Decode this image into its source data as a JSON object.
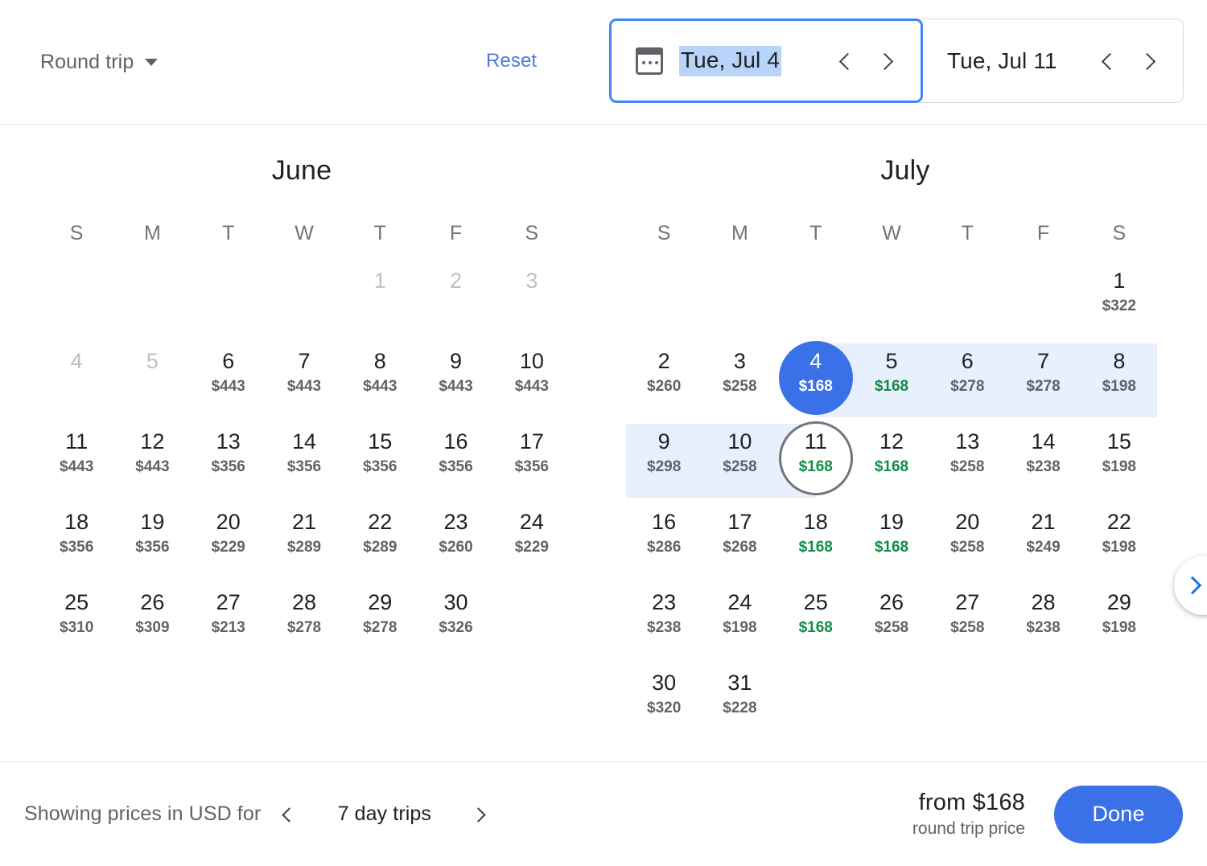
{
  "header": {
    "trip_type": "Round trip",
    "trip_type_icon": "chevron-down-icon",
    "reset_label": "Reset",
    "depart": {
      "icon": "calendar-icon",
      "value": "Tue, Jul 4",
      "prev_icon": "chevron-left-icon",
      "next_icon": "chevron-right-icon"
    },
    "return": {
      "value": "Tue, Jul 11",
      "prev_icon": "chevron-left-icon",
      "next_icon": "chevron-right-icon"
    }
  },
  "weekday_headers": [
    "S",
    "M",
    "T",
    "W",
    "T",
    "F",
    "S"
  ],
  "months": [
    {
      "name": "June",
      "lead_blanks": 4,
      "days": [
        {
          "day": "1",
          "price": "",
          "state": "disabled"
        },
        {
          "day": "2",
          "price": "",
          "state": "disabled"
        },
        {
          "day": "3",
          "price": "",
          "state": "disabled"
        },
        {
          "day": "4",
          "price": "",
          "state": "disabled"
        },
        {
          "day": "5",
          "price": "",
          "state": "disabled"
        },
        {
          "day": "6",
          "price": "$443",
          "state": "normal"
        },
        {
          "day": "7",
          "price": "$443",
          "state": "normal"
        },
        {
          "day": "8",
          "price": "$443",
          "state": "normal"
        },
        {
          "day": "9",
          "price": "$443",
          "state": "normal"
        },
        {
          "day": "10",
          "price": "$443",
          "state": "normal"
        },
        {
          "day": "11",
          "price": "$443",
          "state": "normal"
        },
        {
          "day": "12",
          "price": "$443",
          "state": "normal"
        },
        {
          "day": "13",
          "price": "$356",
          "state": "normal"
        },
        {
          "day": "14",
          "price": "$356",
          "state": "normal"
        },
        {
          "day": "15",
          "price": "$356",
          "state": "normal"
        },
        {
          "day": "16",
          "price": "$356",
          "state": "normal"
        },
        {
          "day": "17",
          "price": "$356",
          "state": "normal"
        },
        {
          "day": "18",
          "price": "$356",
          "state": "normal"
        },
        {
          "day": "19",
          "price": "$356",
          "state": "normal"
        },
        {
          "day": "20",
          "price": "$229",
          "state": "normal"
        },
        {
          "day": "21",
          "price": "$289",
          "state": "normal"
        },
        {
          "day": "22",
          "price": "$289",
          "state": "normal"
        },
        {
          "day": "23",
          "price": "$260",
          "state": "normal"
        },
        {
          "day": "24",
          "price": "$229",
          "state": "normal"
        },
        {
          "day": "25",
          "price": "$310",
          "state": "normal"
        },
        {
          "day": "26",
          "price": "$309",
          "state": "normal"
        },
        {
          "day": "27",
          "price": "$213",
          "state": "normal"
        },
        {
          "day": "28",
          "price": "$278",
          "state": "normal"
        },
        {
          "day": "29",
          "price": "$278",
          "state": "normal"
        },
        {
          "day": "30",
          "price": "$326",
          "state": "normal"
        }
      ]
    },
    {
      "name": "July",
      "lead_blanks": 6,
      "days": [
        {
          "day": "1",
          "price": "$322",
          "state": "normal"
        },
        {
          "day": "2",
          "price": "$260",
          "state": "normal"
        },
        {
          "day": "3",
          "price": "$258",
          "state": "normal"
        },
        {
          "day": "4",
          "price": "$168",
          "state": "selected"
        },
        {
          "day": "5",
          "price": "$168",
          "state": "in-range",
          "low": true
        },
        {
          "day": "6",
          "price": "$278",
          "state": "in-range"
        },
        {
          "day": "7",
          "price": "$278",
          "state": "in-range"
        },
        {
          "day": "8",
          "price": "$198",
          "state": "in-range"
        },
        {
          "day": "9",
          "price": "$298",
          "state": "in-range"
        },
        {
          "day": "10",
          "price": "$258",
          "state": "in-range"
        },
        {
          "day": "11",
          "price": "$168",
          "state": "outlined",
          "low": true
        },
        {
          "day": "12",
          "price": "$168",
          "state": "normal",
          "low": true
        },
        {
          "day": "13",
          "price": "$258",
          "state": "normal"
        },
        {
          "day": "14",
          "price": "$238",
          "state": "normal"
        },
        {
          "day": "15",
          "price": "$198",
          "state": "normal"
        },
        {
          "day": "16",
          "price": "$286",
          "state": "normal"
        },
        {
          "day": "17",
          "price": "$268",
          "state": "normal"
        },
        {
          "day": "18",
          "price": "$168",
          "state": "normal",
          "low": true
        },
        {
          "day": "19",
          "price": "$168",
          "state": "normal",
          "low": true
        },
        {
          "day": "20",
          "price": "$258",
          "state": "normal"
        },
        {
          "day": "21",
          "price": "$249",
          "state": "normal"
        },
        {
          "day": "22",
          "price": "$198",
          "state": "normal"
        },
        {
          "day": "23",
          "price": "$238",
          "state": "normal"
        },
        {
          "day": "24",
          "price": "$198",
          "state": "normal"
        },
        {
          "day": "25",
          "price": "$168",
          "state": "normal",
          "low": true
        },
        {
          "day": "26",
          "price": "$258",
          "state": "normal"
        },
        {
          "day": "27",
          "price": "$258",
          "state": "normal"
        },
        {
          "day": "28",
          "price": "$238",
          "state": "normal"
        },
        {
          "day": "29",
          "price": "$198",
          "state": "normal"
        },
        {
          "day": "30",
          "price": "$320",
          "state": "normal"
        },
        {
          "day": "31",
          "price": "$228",
          "state": "normal"
        }
      ]
    }
  ],
  "next_month_button": {
    "icon": "chevron-right-icon"
  },
  "footer": {
    "showing_label": "Showing prices in USD for",
    "prev_icon": "chevron-left-icon",
    "trip_length": "7 day trips",
    "next_icon": "chevron-right-icon",
    "from_price": "from $168",
    "price_subtitle": "round trip price",
    "done_label": "Done"
  },
  "colors": {
    "accent_blue": "#3b71e8",
    "link_blue": "#4a7ce0",
    "focus_border": "#4285f4",
    "range_band": "#e8f0fe",
    "text_selection": "#b8d4f9",
    "low_price_green": "#128b45",
    "muted_text": "#5f6368",
    "disabled_text": "#bdc1c6"
  }
}
